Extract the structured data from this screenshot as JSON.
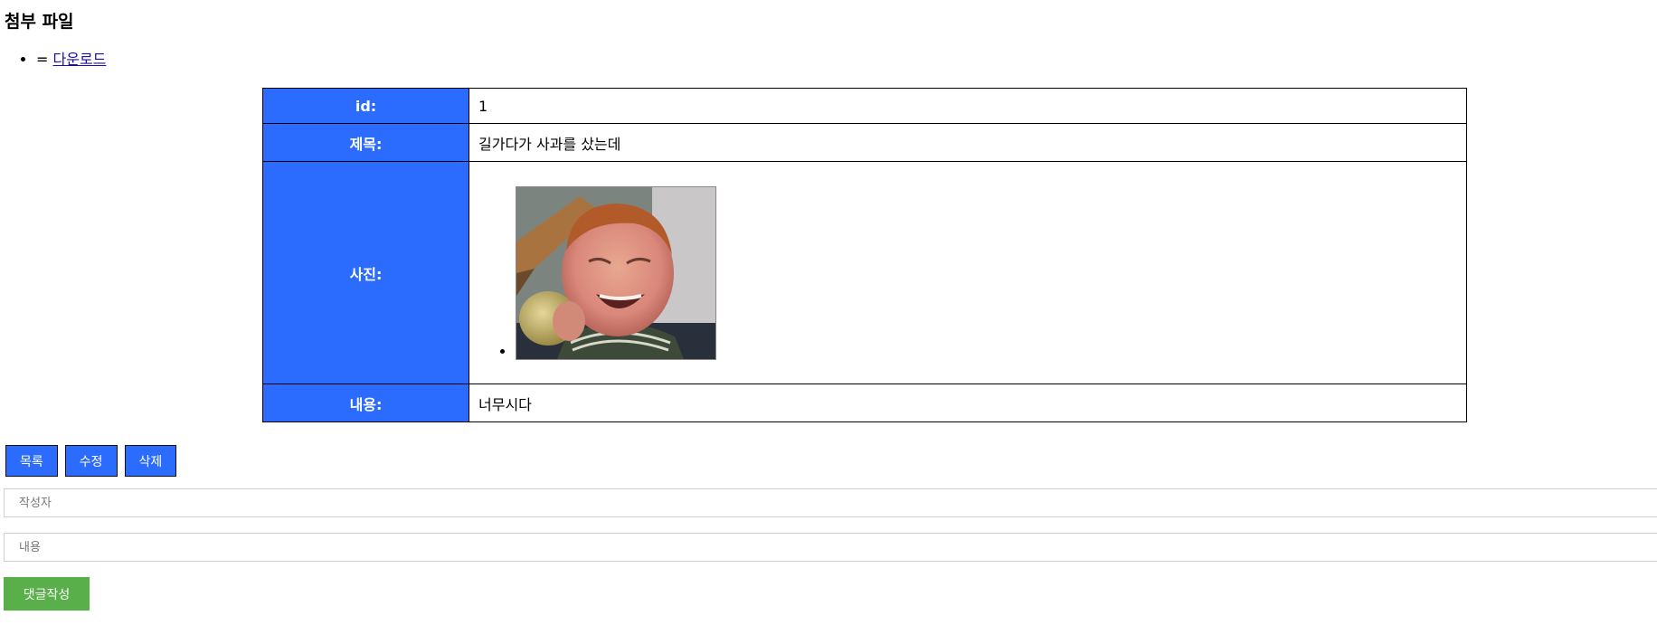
{
  "attachments": {
    "heading": "첨부 파일",
    "items": [
      {
        "prefix": "= ",
        "link_label": "다운로드"
      }
    ]
  },
  "post": {
    "id_label": "id:",
    "id_value": "1",
    "title_label": "제목:",
    "title_value": "길가다가 사과를 샀는데",
    "photo_label": "사진:",
    "content_label": "내용:",
    "content_value": "너무시다"
  },
  "actions": {
    "list_label": "목록",
    "edit_label": "수정",
    "delete_label": "삭제"
  },
  "comment_form": {
    "author_placeholder": "작성자",
    "content_placeholder": "내용",
    "submit_label": "댓글작성"
  },
  "colors": {
    "header_cell": "#2b6cff",
    "primary_button": "#2b6cff",
    "submit_button": "#59b04a"
  }
}
